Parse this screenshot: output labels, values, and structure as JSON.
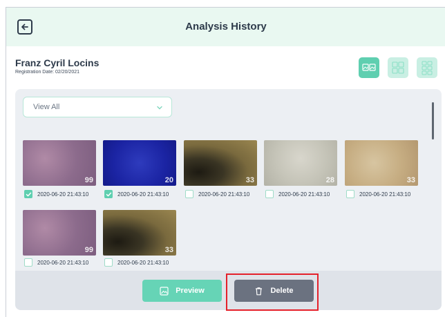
{
  "header": {
    "title": "Analysis History",
    "back_icon": "arrow-left-icon"
  },
  "user": {
    "name": "Franz Cyril Locins",
    "registration": "Registration Date: 02/20/2021"
  },
  "view_modes": [
    {
      "icon": "grid-2-icon",
      "active": true
    },
    {
      "icon": "grid-4-icon",
      "active": false
    },
    {
      "icon": "grid-6-icon",
      "active": false
    }
  ],
  "filter": {
    "selected": "View All"
  },
  "images": [
    {
      "value": "99",
      "date": "2020-06-20 21:43:10",
      "checked": true,
      "tone": "purple"
    },
    {
      "value": "20",
      "date": "2020-06-20 21:43:10",
      "checked": true,
      "tone": "blue"
    },
    {
      "value": "33",
      "date": "2020-06-20 21:43:10",
      "checked": false,
      "tone": "dark"
    },
    {
      "value": "28",
      "date": "2020-06-20 21:43:10",
      "checked": false,
      "tone": "pale"
    },
    {
      "value": "33",
      "date": "2020-06-20 21:43:10",
      "checked": false,
      "tone": "beige"
    },
    {
      "value": "99",
      "date": "2020-06-20 21:43:10",
      "checked": false,
      "tone": "purple"
    },
    {
      "value": "33",
      "date": "2020-06-20 21:43:10",
      "checked": false,
      "tone": "dark"
    }
  ],
  "actions": {
    "preview_label": "Preview",
    "delete_label": "Delete"
  },
  "colors": {
    "accent": "#5fcfb0",
    "header_bg": "#e9f8f1",
    "delete_bg": "#6b7280",
    "highlight": "#e5202a"
  }
}
